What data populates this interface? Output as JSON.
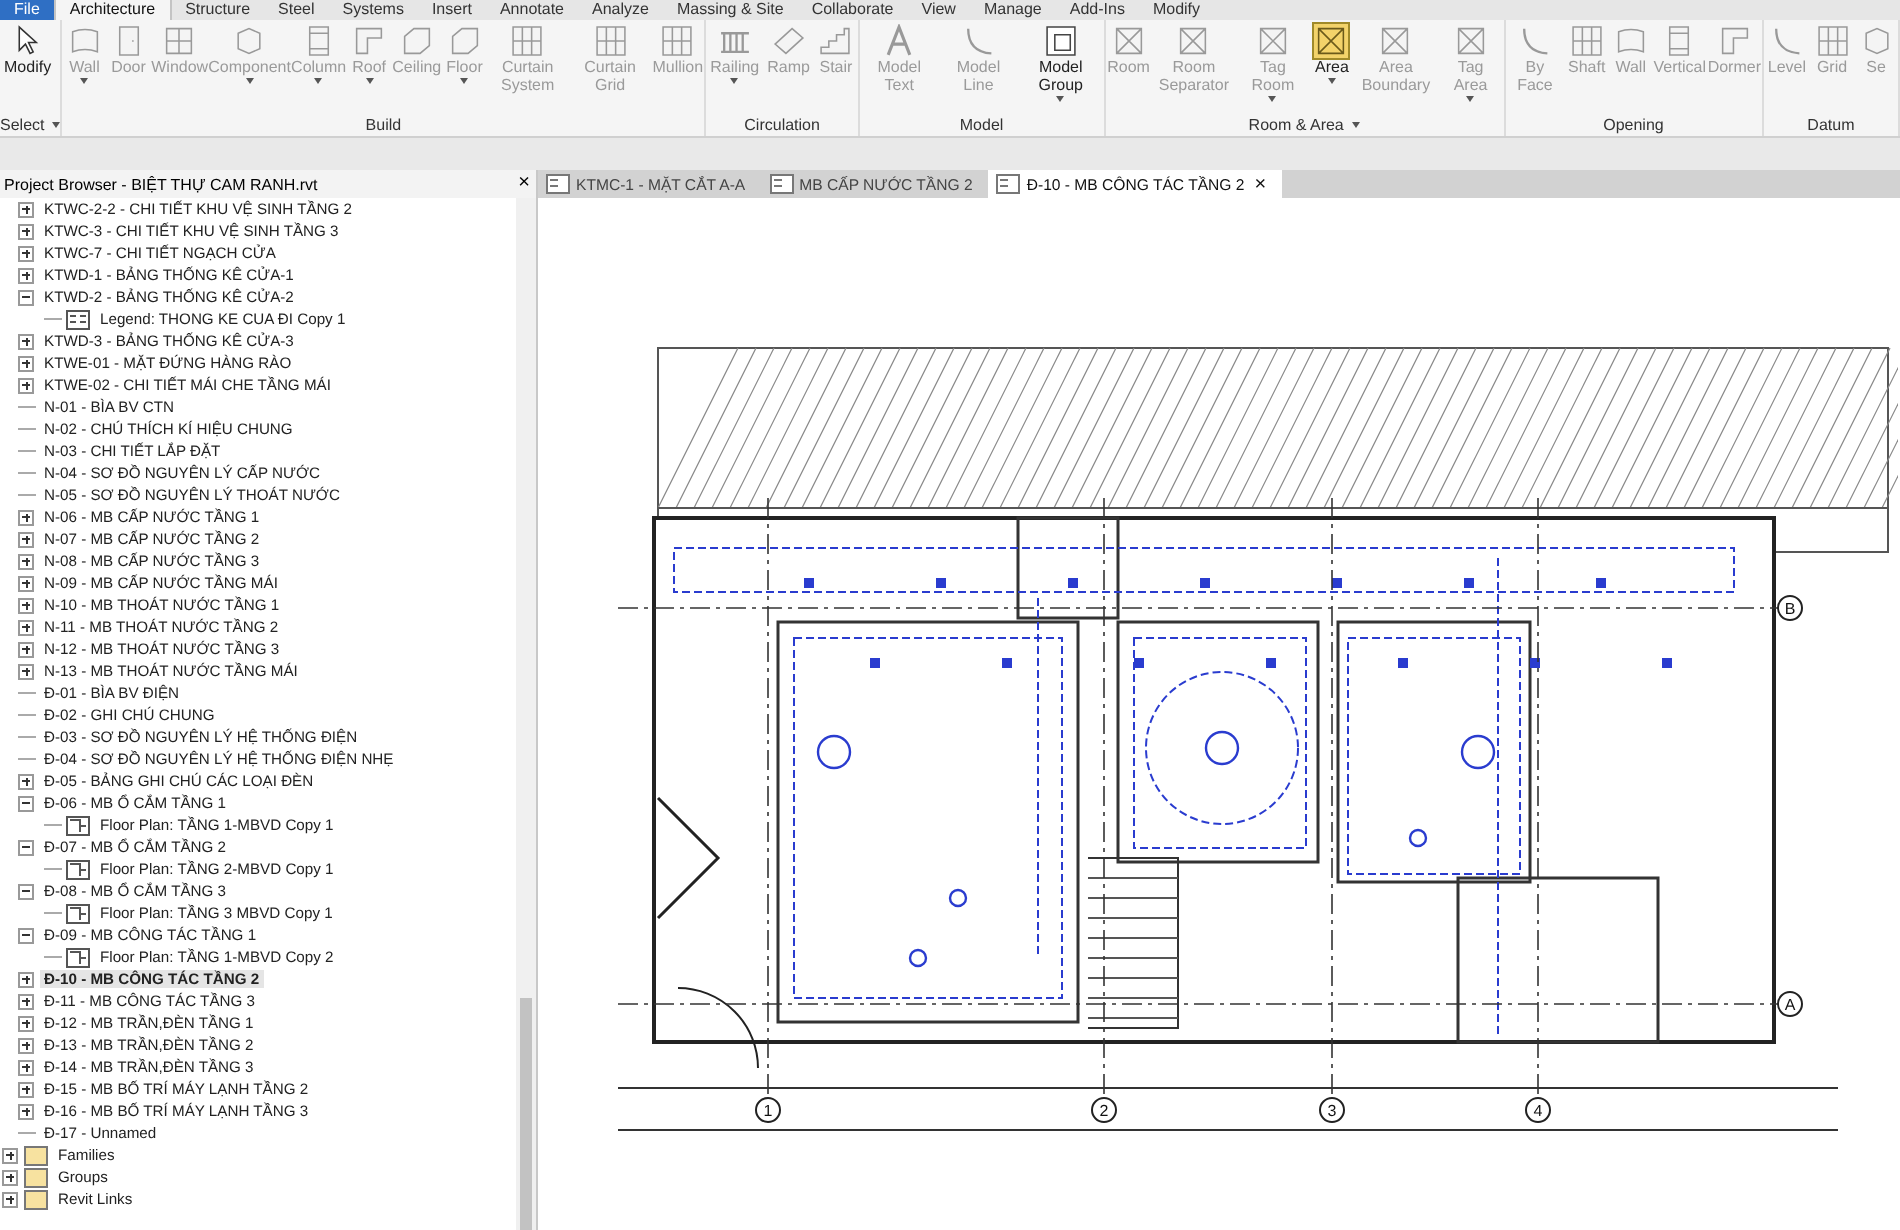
{
  "menu_tabs": [
    {
      "label": "File",
      "selected": false
    },
    {
      "label": "Architecture",
      "selected": true
    },
    {
      "label": "Structure",
      "selected": false
    },
    {
      "label": "Steel",
      "selected": false
    },
    {
      "label": "Systems",
      "selected": false
    },
    {
      "label": "Insert",
      "selected": false
    },
    {
      "label": "Annotate",
      "selected": false
    },
    {
      "label": "Analyze",
      "selected": false
    },
    {
      "label": "Massing & Site",
      "selected": false
    },
    {
      "label": "Collaborate",
      "selected": false
    },
    {
      "label": "View",
      "selected": false
    },
    {
      "label": "Manage",
      "selected": false
    },
    {
      "label": "Add-Ins",
      "selected": false
    },
    {
      "label": "Modify",
      "selected": false
    }
  ],
  "ribbon": [
    {
      "title": "Select",
      "dropdown": true,
      "tools": [
        {
          "label": "Modify",
          "kind": "cursor",
          "disabled": false,
          "selected": false,
          "menu": false
        }
      ]
    },
    {
      "title": "Build",
      "dropdown": false,
      "tools": [
        {
          "label": "Wall",
          "kind": "wall",
          "disabled": true,
          "selected": false,
          "menu": true
        },
        {
          "label": "Door",
          "kind": "door",
          "disabled": true,
          "selected": false,
          "menu": false
        },
        {
          "label": "Window",
          "kind": "window",
          "disabled": true,
          "selected": false,
          "menu": false
        },
        {
          "label": "Component",
          "kind": "box",
          "disabled": true,
          "selected": false,
          "menu": true
        },
        {
          "label": "Column",
          "kind": "column",
          "disabled": true,
          "selected": false,
          "menu": true
        },
        {
          "label": "Roof",
          "kind": "roof",
          "disabled": true,
          "selected": false,
          "menu": true
        },
        {
          "label": "Ceiling",
          "kind": "slab",
          "disabled": true,
          "selected": false,
          "menu": false
        },
        {
          "label": "Floor",
          "kind": "slab",
          "disabled": true,
          "selected": false,
          "menu": true
        },
        {
          "label": "Curtain System",
          "kind": "grid",
          "disabled": true,
          "selected": false,
          "menu": false
        },
        {
          "label": "Curtain Grid",
          "kind": "grid",
          "disabled": true,
          "selected": false,
          "menu": false
        },
        {
          "label": "Mullion",
          "kind": "grid",
          "disabled": true,
          "selected": false,
          "menu": false
        }
      ]
    },
    {
      "title": "Circulation",
      "dropdown": false,
      "tools": [
        {
          "label": "Railing",
          "kind": "railing",
          "disabled": true,
          "selected": false,
          "menu": true
        },
        {
          "label": "Ramp",
          "kind": "ramp",
          "disabled": true,
          "selected": false,
          "menu": false
        },
        {
          "label": "Stair",
          "kind": "stair",
          "disabled": true,
          "selected": false,
          "menu": false
        }
      ]
    },
    {
      "title": "Model",
      "dropdown": false,
      "tools": [
        {
          "label": "Model Text",
          "kind": "text",
          "disabled": true,
          "selected": false,
          "menu": false
        },
        {
          "label": "Model Line",
          "kind": "line",
          "disabled": true,
          "selected": false,
          "menu": false
        },
        {
          "label": "Model Group",
          "kind": "group",
          "disabled": false,
          "selected": false,
          "menu": true
        }
      ]
    },
    {
      "title": "Room & Area",
      "dropdown": true,
      "tools": [
        {
          "label": "Room",
          "kind": "room",
          "disabled": true,
          "selected": false,
          "menu": false
        },
        {
          "label": "Room Separator",
          "kind": "room",
          "disabled": true,
          "selected": false,
          "menu": false
        },
        {
          "label": "Tag Room",
          "kind": "room",
          "disabled": true,
          "selected": false,
          "menu": true
        },
        {
          "label": "Area",
          "kind": "room",
          "disabled": false,
          "selected": true,
          "menu": true
        },
        {
          "label": "Area Boundary",
          "kind": "room",
          "disabled": true,
          "selected": false,
          "menu": false
        },
        {
          "label": "Tag Area",
          "kind": "room",
          "disabled": true,
          "selected": false,
          "menu": true
        }
      ]
    },
    {
      "title": "Opening",
      "dropdown": false,
      "tools": [
        {
          "label": "By Face",
          "kind": "line",
          "disabled": true,
          "selected": false,
          "menu": false
        },
        {
          "label": "Shaft",
          "kind": "grid",
          "disabled": true,
          "selected": false,
          "menu": false
        },
        {
          "label": "Wall",
          "kind": "wall",
          "disabled": true,
          "selected": false,
          "menu": false
        },
        {
          "label": "Vertical",
          "kind": "column",
          "disabled": true,
          "selected": false,
          "menu": false
        },
        {
          "label": "Dormer",
          "kind": "roof",
          "disabled": true,
          "selected": false,
          "menu": false
        }
      ]
    },
    {
      "title": "Datum",
      "dropdown": false,
      "tools": [
        {
          "label": "Level",
          "kind": "line",
          "disabled": true,
          "selected": false,
          "menu": false
        },
        {
          "label": "Grid",
          "kind": "grid",
          "disabled": true,
          "selected": false,
          "menu": false
        },
        {
          "label": "Se",
          "kind": "box",
          "disabled": true,
          "selected": false,
          "menu": false
        }
      ]
    }
  ],
  "browser": {
    "title": "Project Browser - BIỆT THỰ CAM RANH.rvt",
    "close": "×",
    "items": [
      {
        "label": "KTWC-2-2 - CHI TIẾT KHU VỆ SINH TẦNG 2",
        "kind": "sheet",
        "expanded": false,
        "selected": false
      },
      {
        "label": "KTWC-3 - CHI TIẾT KHU VỆ SINH TẦNG 3",
        "kind": "sheet",
        "expanded": false,
        "selected": false
      },
      {
        "label": "KTWC-7 - CHI TIẾT NGẠCH CỬA",
        "kind": "sheet",
        "expanded": false,
        "selected": false
      },
      {
        "label": "KTWD-1 - BẢNG THỐNG KÊ CỬA-1",
        "kind": "sheet",
        "expanded": false,
        "selected": false
      },
      {
        "label": "KTWD-2 - BẢNG THỐNG KÊ CỬA-2",
        "kind": "sheet",
        "expanded": true,
        "selected": false,
        "children": [
          {
            "label": "Legend: THONG KE CUA ĐI Copy 1",
            "kind": "legend",
            "selected": false
          }
        ]
      },
      {
        "label": "KTWD-3 - BẢNG THỐNG KÊ CỬA-3",
        "kind": "sheet",
        "expanded": false,
        "selected": false
      },
      {
        "label": "KTWE-01 - MẶT ĐỨNG HÀNG RÀO",
        "kind": "sheet",
        "expanded": false,
        "selected": false
      },
      {
        "label": "KTWE-02 - CHI TIẾT MÁI CHE TẦNG MÁI",
        "kind": "sheet",
        "expanded": false,
        "selected": false
      },
      {
        "label": "N-01 - BÌA BV CTN",
        "kind": "leaf",
        "selected": false
      },
      {
        "label": "N-02 - CHÚ THÍCH KÍ HIỆU CHUNG",
        "kind": "leaf",
        "selected": false
      },
      {
        "label": "N-03 - CHI TIẾT LẮP ĐẶT",
        "kind": "leaf",
        "selected": false
      },
      {
        "label": "N-04 - SƠ ĐỒ NGUYÊN LÝ CẤP NƯỚC",
        "kind": "leaf",
        "selected": false
      },
      {
        "label": "N-05 - SƠ ĐỒ NGUYÊN LÝ THOÁT NƯỚC",
        "kind": "leaf",
        "selected": false
      },
      {
        "label": "N-06 - MB CẤP NƯỚC TẦNG 1",
        "kind": "sheet",
        "expanded": false,
        "selected": false
      },
      {
        "label": "N-07 - MB CẤP NƯỚC TẦNG 2",
        "kind": "sheet",
        "expanded": false,
        "selected": false
      },
      {
        "label": "N-08 - MB CẤP NƯỚC TẦNG 3",
        "kind": "sheet",
        "expanded": false,
        "selected": false
      },
      {
        "label": "N-09 - MB CẤP NƯỚC TẦNG MÁI",
        "kind": "sheet",
        "expanded": false,
        "selected": false
      },
      {
        "label": "N-10 - MB THOÁT NƯỚC TẦNG 1",
        "kind": "sheet",
        "expanded": false,
        "selected": false
      },
      {
        "label": "N-11 - MB THOÁT NƯỚC TẦNG 2",
        "kind": "sheet",
        "expanded": false,
        "selected": false
      },
      {
        "label": "N-12 - MB THOÁT NƯỚC TẦNG 3",
        "kind": "sheet",
        "expanded": false,
        "selected": false
      },
      {
        "label": "N-13 - MB THOÁT NƯỚC TẦNG MÁI",
        "kind": "sheet",
        "expanded": false,
        "selected": false
      },
      {
        "label": "Đ-01 - BÌA BV ĐIỆN",
        "kind": "leaf",
        "selected": false
      },
      {
        "label": "Đ-02 - GHI CHÚ CHUNG",
        "kind": "leaf",
        "selected": false
      },
      {
        "label": "Đ-03 - SƠ ĐỒ NGUYÊN LÝ HỆ THỐNG ĐIỆN",
        "kind": "leaf",
        "selected": false
      },
      {
        "label": "Đ-04 - SƠ ĐỒ NGUYÊN LÝ HỆ THỐNG ĐIỆN NHẸ",
        "kind": "leaf",
        "selected": false
      },
      {
        "label": "Đ-05 - BẢNG GHI CHÚ CÁC LOẠI ĐÈN",
        "kind": "sheet",
        "expanded": false,
        "selected": false
      },
      {
        "label": "Đ-06 - MB  Ổ CẮM TẦNG 1",
        "kind": "sheet",
        "expanded": true,
        "selected": false,
        "children": [
          {
            "label": "Floor Plan: TẦNG 1-MBVD Copy 1",
            "kind": "plan",
            "selected": false
          }
        ]
      },
      {
        "label": "Đ-07 - MB  Ổ CẮM TẦNG 2",
        "kind": "sheet",
        "expanded": true,
        "selected": false,
        "children": [
          {
            "label": "Floor Plan: TẦNG 2-MBVD Copy 1",
            "kind": "plan",
            "selected": false
          }
        ]
      },
      {
        "label": "Đ-08 - MB  Ổ CẮM TẦNG 3",
        "kind": "sheet",
        "expanded": true,
        "selected": false,
        "children": [
          {
            "label": "Floor Plan: TẦNG 3 MBVD Copy 1",
            "kind": "plan",
            "selected": false
          }
        ]
      },
      {
        "label": "Đ-09 - MB  CÔNG TÁC TẦNG 1",
        "kind": "sheet",
        "expanded": true,
        "selected": false,
        "children": [
          {
            "label": "Floor Plan: TẦNG 1-MBVD Copy 2",
            "kind": "plan",
            "selected": false
          }
        ]
      },
      {
        "label": "Đ-10 - MB  CÔNG TÁC TẦNG 2",
        "kind": "sheet",
        "expanded": false,
        "selected": true
      },
      {
        "label": "Đ-11 - MB  CÔNG TÁC TẦNG 3",
        "kind": "sheet",
        "expanded": false,
        "selected": false
      },
      {
        "label": "Đ-12 - MB TRẦN,ĐÈN  TẦNG 1",
        "kind": "sheet",
        "expanded": false,
        "selected": false
      },
      {
        "label": "Đ-13 - MB TRẦN,ĐÈN  TẦNG 2",
        "kind": "sheet",
        "expanded": false,
        "selected": false
      },
      {
        "label": "Đ-14 - MB TRẦN,ĐÈN  TẦNG 3",
        "kind": "sheet",
        "expanded": false,
        "selected": false
      },
      {
        "label": "Đ-15 - MB BỐ TRÍ MÁY LẠNH TẦNG 2",
        "kind": "sheet",
        "expanded": false,
        "selected": false
      },
      {
        "label": "Đ-16 - MB BỐ TRÍ MÁY LẠNH TẦNG 3",
        "kind": "sheet",
        "expanded": false,
        "selected": false
      },
      {
        "label": "Đ-17 - Unnamed",
        "kind": "leaf",
        "selected": false
      }
    ],
    "categories": [
      {
        "label": "Families",
        "expanded": false
      },
      {
        "label": "Groups",
        "expanded": false
      },
      {
        "label": "Revit Links",
        "expanded": false
      }
    ]
  },
  "doc_tabs": [
    {
      "label": "KTMC-1 - MẶT CẮT A-A",
      "selected": false
    },
    {
      "label": "MB CẤP NƯỚC TẦNG 2",
      "selected": false
    },
    {
      "label": "Đ-10 - MB  CÔNG TÁC TẦNG 2",
      "selected": true,
      "close": "×"
    }
  ],
  "plan": {
    "vertical_grids": [
      "1",
      "2",
      "3",
      "4"
    ],
    "horizontal_grids": [
      "B",
      "A"
    ]
  }
}
